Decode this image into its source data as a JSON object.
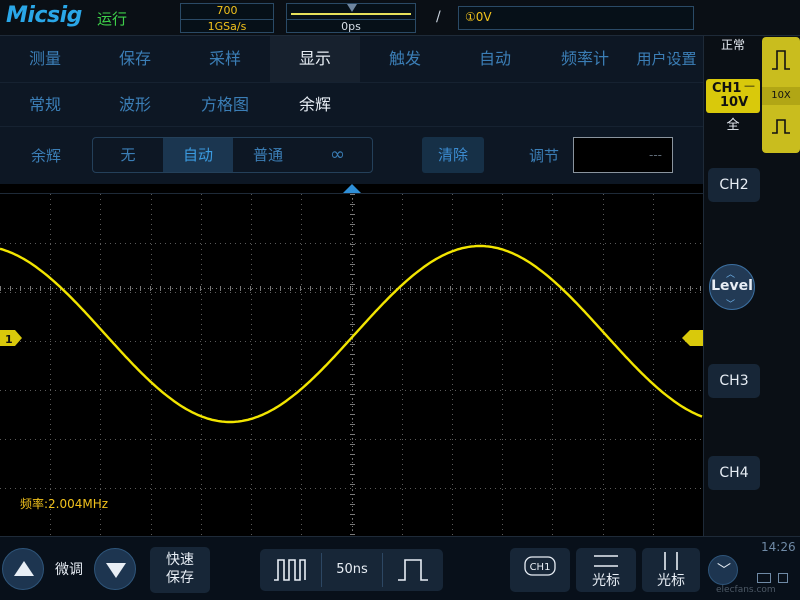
{
  "header": {
    "logo": "Micsig",
    "run_state": "运行",
    "memory_depth": "700",
    "sample_rate": "1GSa/s",
    "trigger_position": "0ps",
    "trigger_edge": "/",
    "trigger_level": "①0V"
  },
  "menu": {
    "tabs": [
      "测量",
      "保存",
      "采样",
      "显示",
      "触发",
      "自动",
      "频率计",
      "用户设置"
    ],
    "active_tab": "显示",
    "subtabs": [
      "常规",
      "波形",
      "方格图",
      "余辉"
    ],
    "active_subtab": "余辉",
    "persistence_label": "余辉",
    "persistence_options": [
      "无",
      "自动",
      "普通",
      "∞"
    ],
    "persistence_selected": "自动",
    "clear_label": "清除",
    "adjust_label": "调节",
    "adjust_value": "---"
  },
  "display": {
    "frequency_readout": "频率:2.004MHz",
    "ch1_marker": "1"
  },
  "right_panel": {
    "status": "正常",
    "ch1_name": "CH1",
    "ch1_coupling": "—",
    "ch1_scale": "10V",
    "ch1_bandwidth": "全",
    "probe_ratio": "10X",
    "ch2": "CH2",
    "level": "Level",
    "ch3": "CH3",
    "ch4": "CH4"
  },
  "bottom": {
    "fine_label": "微调",
    "quick_save_line1": "快速",
    "quick_save_line2": "保存",
    "timebase": "50ns",
    "ch1_button": "CH1",
    "cursor1_label": "光标",
    "cursor2_label": "光标",
    "clock": "14:26",
    "watermark": "elecfans.com"
  },
  "colors": {
    "waveform": "#f2e500",
    "accent_blue": "#3b7eb6",
    "ch1_yellow": "#d9c90b"
  }
}
